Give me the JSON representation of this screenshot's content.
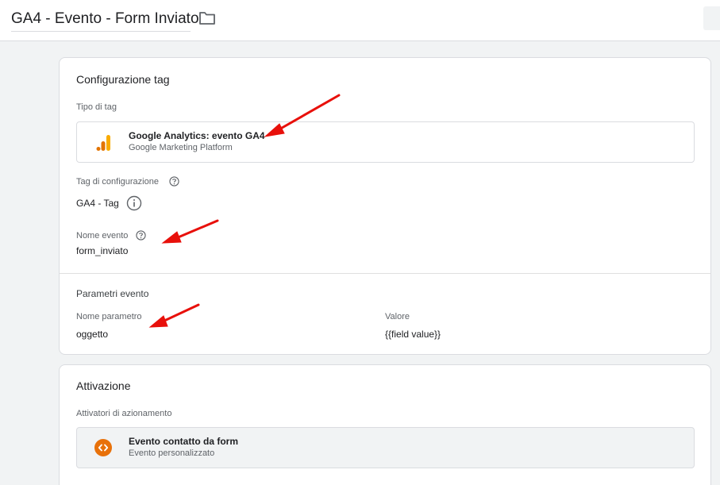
{
  "header": {
    "tag_name": "GA4 - Evento - Form Inviato",
    "folder_icon": "folder-icon"
  },
  "config": {
    "heading": "Configurazione tag",
    "tag_type_label": "Tipo di tag",
    "tag_type": {
      "title": "Google Analytics: evento GA4",
      "subtitle": "Google Marketing Platform",
      "icon": "google-analytics-icon",
      "icon_color": "#f9ab00"
    },
    "config_tag_label": "Tag di configurazione",
    "config_tag_value": "GA4 - Tag",
    "event_name_label": "Nome evento",
    "event_name_value": "form_inviato",
    "params_heading": "Parametri evento",
    "param_name_header": "Nome parametro",
    "param_value_header": "Valore",
    "params": [
      {
        "name": "oggetto",
        "value": "{{field value}}"
      }
    ]
  },
  "triggering": {
    "heading": "Attivazione",
    "triggers_label": "Attivatori di azionamento",
    "trigger": {
      "title": "Evento contatto da form",
      "subtitle": "Evento personalizzato",
      "icon": "custom-event-icon",
      "icon_color": "#e8710a"
    }
  },
  "annotations": {
    "arrow_color": "#e8100b"
  }
}
